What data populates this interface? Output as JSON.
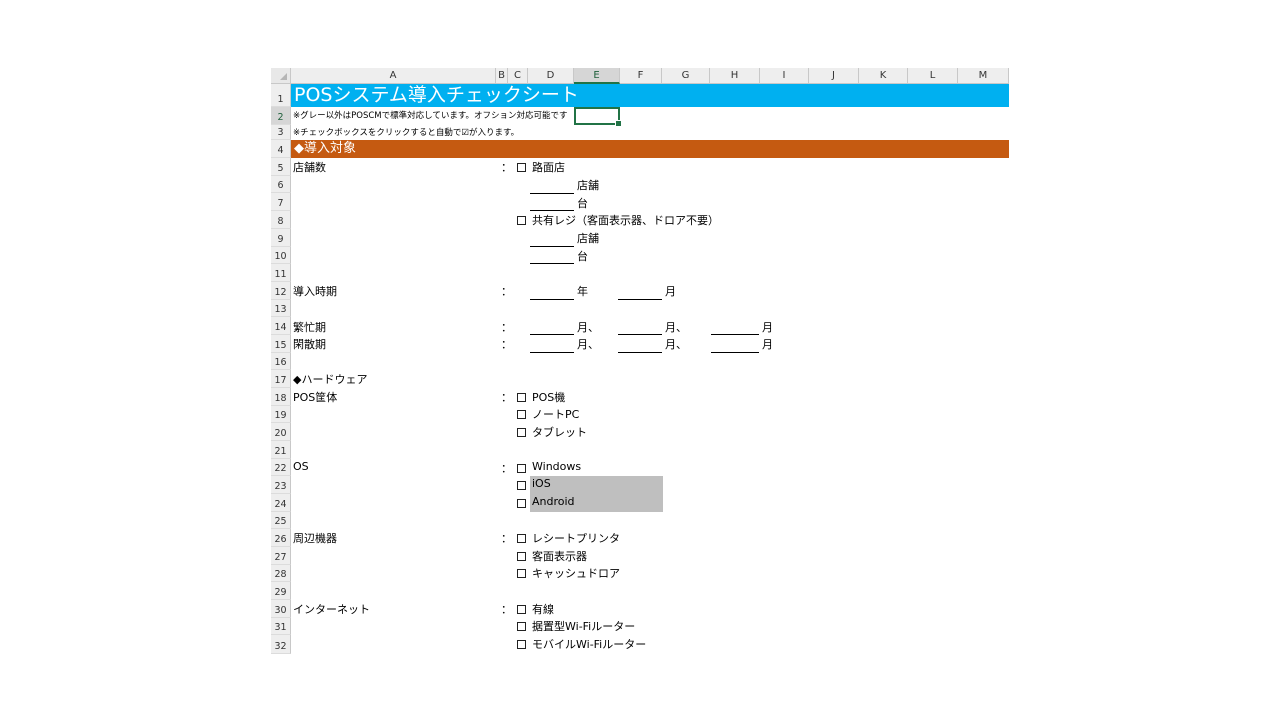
{
  "columns": [
    "A",
    "B",
    "C",
    "D",
    "E",
    "F",
    "G",
    "H",
    "I",
    "J",
    "K",
    "L",
    "M"
  ],
  "selected_column": "E",
  "selected_row": "2",
  "rows": [
    "1",
    "2",
    "3",
    "4",
    "5",
    "6",
    "7",
    "8",
    "9",
    "10",
    "11",
    "12",
    "13",
    "14",
    "15",
    "16",
    "17",
    "18",
    "19",
    "20",
    "21",
    "22",
    "23",
    "24",
    "25",
    "26",
    "27",
    "28",
    "29",
    "30",
    "31",
    "32"
  ],
  "title": "POSシステム導入チェックシート",
  "note1": "※グレー以外はPOSCMで標準対応しています。オフション対応可能です",
  "note2": "※チェックボックスをクリックすると自動で☑が入ります。",
  "section1": "◆導入対象",
  "colon": "：",
  "stores": {
    "label": "店舗数",
    "opt1": "路面店",
    "opt2": "共有レジ（客面表示器、ドロア不要）",
    "unit_store": "店舗",
    "unit_unit": "台"
  },
  "timing": {
    "label": "導入時期",
    "year": "年",
    "month": "月"
  },
  "busy": {
    "label": "繁忙期",
    "month_sep": "月、",
    "month": "月"
  },
  "slow": {
    "label": "閑散期",
    "month_sep": "月、",
    "month": "月"
  },
  "section2": "◆ハードウェア",
  "pos_body": {
    "label": "POS筐体",
    "opts": [
      "POS機",
      "ノートPC",
      "タブレット"
    ]
  },
  "os": {
    "label": "OS",
    "opts": [
      "Windows",
      "iOS",
      "Android"
    ]
  },
  "peripherals": {
    "label": "周辺機器",
    "opts": [
      "レシートプリンタ",
      "客面表示器",
      "キャッシュドロア"
    ]
  },
  "internet": {
    "label": "インターネット",
    "opts": [
      "有線",
      "据置型Wi-Fiルーター",
      "モバイルWi-Fiルーター"
    ]
  },
  "colors": {
    "title_bg": "#00b0f0",
    "section_bg": "#c55a11",
    "grey_cell": "#bfbfbf",
    "select": "#217346"
  }
}
